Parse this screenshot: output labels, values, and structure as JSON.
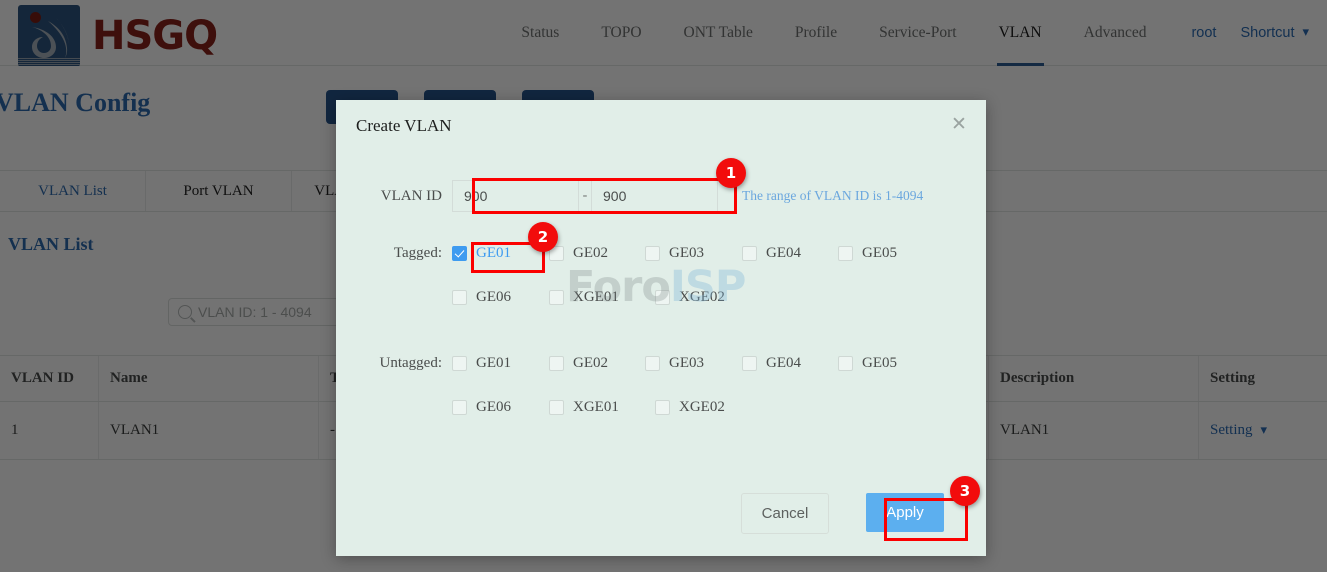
{
  "header": {
    "brand": "HSGQ",
    "nav": [
      {
        "label": "Status",
        "active": false
      },
      {
        "label": "TOPO",
        "active": false
      },
      {
        "label": "ONT Table",
        "active": false
      },
      {
        "label": "Profile",
        "active": false
      },
      {
        "label": "Service-Port",
        "active": false
      },
      {
        "label": "VLAN",
        "active": true
      },
      {
        "label": "Advanced",
        "active": false
      }
    ],
    "user": "root",
    "shortcut": "Shortcut",
    "shortcut_chevron": "chevron-down-icon"
  },
  "page": {
    "title": "VLAN Config",
    "toolbar_buttons": [
      "",
      "",
      ""
    ],
    "tabs": [
      {
        "label": "VLAN List",
        "active": true
      },
      {
        "label": "Port VLAN",
        "active": false
      },
      {
        "label": "VLAN Translate",
        "active": false
      }
    ],
    "sub_title": "VLAN List",
    "search_placeholder": "VLAN ID: 1 - 4094",
    "table": {
      "columns": [
        "VLAN ID",
        "Name",
        "T",
        "",
        "",
        "Description",
        "Setting"
      ],
      "headers": {
        "vlan_id": "VLAN ID",
        "name": "Name",
        "tagged": "T",
        "description": "Description",
        "setting": "Setting"
      },
      "rows": [
        {
          "vlan_id": "1",
          "name": "VLAN1",
          "tagged": "-",
          "description": "VLAN1",
          "setting": "Setting"
        }
      ]
    }
  },
  "modal": {
    "title": "Create VLAN",
    "close_icon": "close-icon",
    "vlan_id_label": "VLAN ID",
    "vlan_id_start": "900",
    "vlan_id_dash": "-",
    "vlan_id_end": "900",
    "range_hint": "The range of VLAN ID is 1-4094",
    "tagged_label": "Tagged:",
    "untagged_label": "Untagged:",
    "tagged_ports": [
      {
        "label": "GE01",
        "checked": true
      },
      {
        "label": "GE02",
        "checked": false
      },
      {
        "label": "GE03",
        "checked": false
      },
      {
        "label": "GE04",
        "checked": false
      },
      {
        "label": "GE05",
        "checked": false
      },
      {
        "label": "GE06",
        "checked": false
      },
      {
        "label": "XGE01",
        "checked": false
      },
      {
        "label": "XGE02",
        "checked": false
      }
    ],
    "untagged_ports": [
      {
        "label": "GE01",
        "checked": false
      },
      {
        "label": "GE02",
        "checked": false
      },
      {
        "label": "GE03",
        "checked": false
      },
      {
        "label": "GE04",
        "checked": false
      },
      {
        "label": "GE05",
        "checked": false
      },
      {
        "label": "GE06",
        "checked": false
      },
      {
        "label": "XGE01",
        "checked": false
      },
      {
        "label": "XGE02",
        "checked": false
      }
    ],
    "cancel_label": "Cancel",
    "apply_label": "Apply"
  },
  "annotations": {
    "badge1": "1",
    "badge2": "2",
    "badge3": "3"
  },
  "watermark": {
    "part1": "Foro",
    "part2": "ISP"
  },
  "colors": {
    "accent_blue": "#2e6bb0",
    "brand_red": "#8a221b",
    "logo_blue": "#2e5580",
    "modal_bg": "#e1eee8",
    "apply_blue": "#5cafef",
    "annotation_red": "#fb0000",
    "checkbox_blue": "#3e9bf0",
    "hint_blue": "#6ba7de"
  }
}
